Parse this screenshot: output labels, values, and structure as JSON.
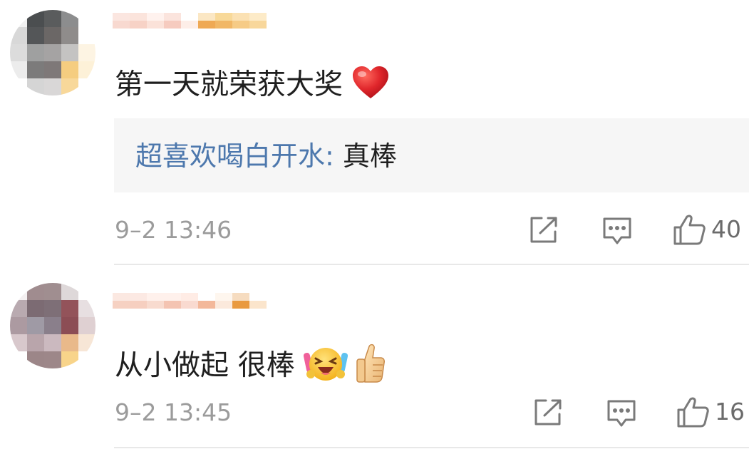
{
  "comments": [
    {
      "text": "第一天就荣获大奖",
      "emoji": "red-heart-icon",
      "reply": {
        "author": "超喜欢喝白开水",
        "separator": ":",
        "message": "真棒"
      },
      "time": "9–2 13:46",
      "likes": "40"
    },
    {
      "text": "从小做起 很棒",
      "emoji": "cheering-face-icon thumbs-up-icon",
      "time": "9–2 13:45",
      "likes": "16"
    }
  ],
  "colors": {
    "reply_author": "#4d78ad",
    "reply_bg": "#f6f6f6",
    "timestamp": "#9b9b9b",
    "heart": "#e0262b"
  }
}
